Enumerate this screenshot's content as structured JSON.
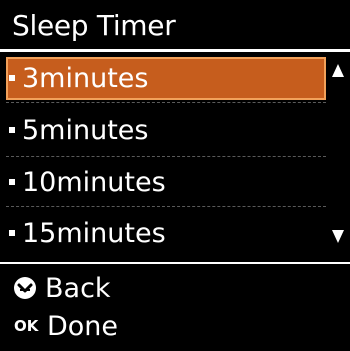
{
  "header": {
    "title": "Sleep Timer"
  },
  "timer_list": {
    "items": [
      {
        "label": "3minutes",
        "selected": true
      },
      {
        "label": "5minutes",
        "selected": false
      },
      {
        "label": "10minutes",
        "selected": false
      },
      {
        "label": "15minutes",
        "selected": false
      }
    ],
    "scroll_up_icon": "triangle-up",
    "scroll_down_icon": "triangle-down"
  },
  "footer": {
    "back_label": "Back",
    "back_icon": "back-button-icon",
    "ok_icon_text": "OK",
    "done_label": "Done"
  },
  "colors": {
    "background": "#000000",
    "text": "#ffffff",
    "selection": "#c65d1d",
    "selection_border": "#f2a15a"
  }
}
